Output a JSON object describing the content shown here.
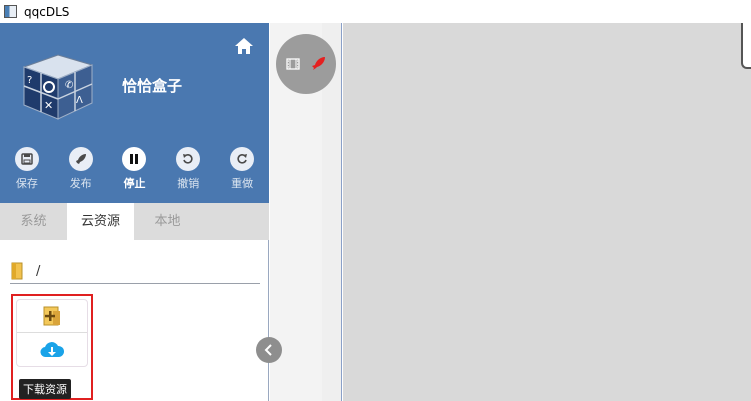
{
  "window": {
    "title": "qqcDLS"
  },
  "header": {
    "brand": "恰恰盒子",
    "home_icon": "home-icon",
    "toolbar": [
      {
        "label": "保存",
        "icon": "save-icon"
      },
      {
        "label": "发布",
        "icon": "rocket-icon"
      },
      {
        "label": "停止",
        "icon": "pause-icon",
        "active": true
      },
      {
        "label": "撤销",
        "icon": "undo-icon"
      },
      {
        "label": "重做",
        "icon": "redo-icon"
      }
    ]
  },
  "tabs": [
    {
      "label": "系统"
    },
    {
      "label": "云资源",
      "active": true
    },
    {
      "label": "本地"
    }
  ],
  "path": {
    "value": "/"
  },
  "resource": {
    "add_icon": "add-folder-icon",
    "download_icon": "cloud-download-icon",
    "tooltip": "下载资源"
  },
  "colors": {
    "header_bg": "#4a78b0",
    "tab_bg": "#dcdcdc",
    "canvas_bg": "#d9d9d9",
    "highlight": "#e02020",
    "rocket": "#e52020",
    "cloud": "#1aa3e8"
  }
}
